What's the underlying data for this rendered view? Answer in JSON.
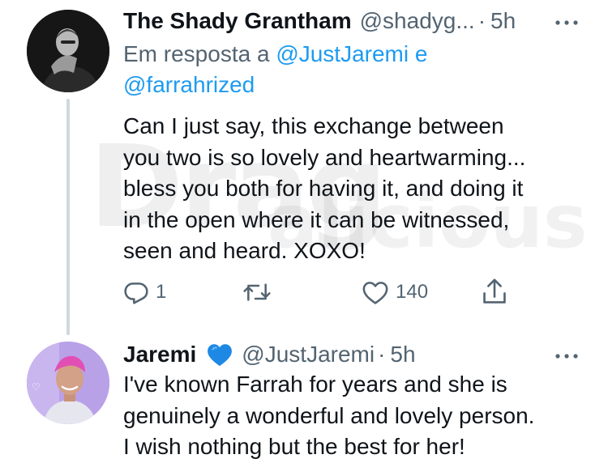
{
  "tweets": [
    {
      "display_name": "The Shady Grantham",
      "handle": "@shadyg...",
      "separator": "·",
      "time": "5h",
      "reply_prefix": "Em resposta a",
      "reply_mention_1": "@JustJaremi",
      "reply_conj": "e",
      "reply_mention_2": "@farrahrized",
      "lines": [
        "Can I just say, this exchange between",
        "you two is so lovely and heartwarming...",
        "bless you both for having it, and doing it",
        "in the open where it can be witnessed,",
        "seen and heard. XOXO!"
      ],
      "reply_count": "1",
      "like_count": "140"
    },
    {
      "display_name": "Jaremi",
      "handle": "@JustJaremi",
      "separator": "·",
      "time": "5h",
      "lines": [
        "I've known Farrah for years and she is",
        "genuinely a wonderful and lovely person.",
        "I wish nothing but the best for her!"
      ]
    }
  ],
  "watermark": "Dragalicious",
  "colors": {
    "link": "#1d9bf0",
    "muted": "#536471",
    "text": "#0f1419",
    "heart": "#1d9bf0"
  },
  "icons": {
    "reply": "reply-icon",
    "retweet": "retweet-icon",
    "like": "like-icon",
    "share": "share-icon",
    "more": "more-icon",
    "heart": "blue-heart-emoji"
  }
}
